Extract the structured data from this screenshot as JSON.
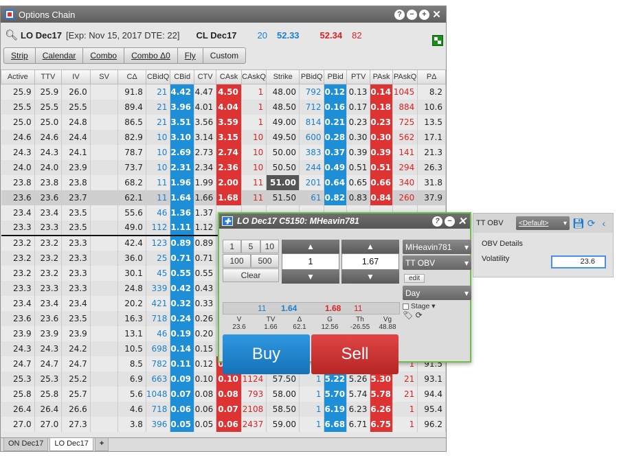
{
  "window": {
    "title": "Options Chain"
  },
  "info": {
    "symbol": "LO Dec17",
    "expiry": "[Exp: Nov 15, 2017 DTE: 22]",
    "underlying": "CL Dec17",
    "bid_qty": "20",
    "bid": "52.33",
    "ask": "52.34",
    "ask_qty": "82"
  },
  "strategies": [
    "Strip",
    "Calendar",
    "Combo",
    "Combo Δ0",
    "Fly",
    "Custom"
  ],
  "columns": [
    "Active",
    "TTV",
    "IV",
    "SV",
    "CΔ",
    "CBidQ",
    "CBid",
    "CTV",
    "CAsk",
    "CAskQ",
    "Strike",
    "PBidQ",
    "PBid",
    "PTV",
    "PAsk",
    "PAskQ",
    "PΔ"
  ],
  "rows": [
    [
      "25.9",
      "25.9",
      "26.0",
      "",
      "91.8",
      "21",
      "4.42",
      "4.47",
      "4.50",
      "1",
      "48.00",
      "792",
      "0.12",
      "0.13",
      "0.14",
      "1045",
      "8.2"
    ],
    [
      "25.5",
      "25.5",
      "25.5",
      "",
      "89.4",
      "21",
      "3.96",
      "4.01",
      "4.04",
      "1",
      "48.50",
      "712",
      "0.16",
      "0.17",
      "0.18",
      "884",
      "10.6"
    ],
    [
      "25.0",
      "25.0",
      "24.8",
      "",
      "86.5",
      "21",
      "3.51",
      "3.56",
      "3.59",
      "1",
      "49.00",
      "814",
      "0.21",
      "0.23",
      "0.23",
      "725",
      "13.5"
    ],
    [
      "24.6",
      "24.6",
      "24.4",
      "",
      "82.9",
      "10",
      "3.10",
      "3.14",
      "3.15",
      "10",
      "49.50",
      "600",
      "0.28",
      "0.30",
      "0.30",
      "562",
      "17.1"
    ],
    [
      "24.3",
      "24.3",
      "24.1",
      "",
      "78.7",
      "10",
      "2.69",
      "2.73",
      "2.74",
      "10",
      "50.00",
      "383",
      "0.37",
      "0.39",
      "0.39",
      "141",
      "21.3"
    ],
    [
      "24.0",
      "24.0",
      "23.9",
      "",
      "73.7",
      "10",
      "2.31",
      "2.34",
      "2.36",
      "10",
      "50.50",
      "244",
      "0.49",
      "0.51",
      "0.51",
      "294",
      "26.3"
    ],
    [
      "23.8",
      "23.8",
      "23.8",
      "",
      "68.2",
      "11",
      "1.96",
      "1.99",
      "2.00",
      "11",
      "51.00",
      "201",
      "0.64",
      "0.65",
      "0.66",
      "340",
      "31.8"
    ],
    [
      "23.6",
      "23.6",
      "23.7",
      "",
      "62.1",
      "11",
      "1.64",
      "1.66",
      "1.68",
      "11",
      "51.50",
      "61",
      "0.82",
      "0.83",
      "0.84",
      "260",
      "37.9"
    ],
    [
      "23.4",
      "23.4",
      "23.5",
      "",
      "55.6",
      "46",
      "1.36",
      "1.37",
      "",
      "",
      "",
      "",
      "",
      "",
      "",
      "",
      ""
    ],
    [
      "23.3",
      "23.3",
      "23.5",
      "",
      "49.0",
      "112",
      "1.11",
      "1.12",
      "",
      "",
      "",
      "",
      "",
      "",
      "",
      "",
      ""
    ],
    [
      "23.2",
      "23.2",
      "23.3",
      "",
      "42.4",
      "123",
      "0.89",
      "0.89",
      "",
      "",
      "",
      "",
      "",
      "",
      "",
      "",
      ""
    ],
    [
      "23.2",
      "23.2",
      "23.3",
      "",
      "36.0",
      "25",
      "0.71",
      "0.71",
      "",
      "",
      "",
      "",
      "",
      "",
      "",
      "",
      ""
    ],
    [
      "23.2",
      "23.2",
      "23.3",
      "",
      "30.1",
      "45",
      "0.55",
      "0.55",
      "",
      "",
      "",
      "",
      "",
      "",
      "",
      "",
      ""
    ],
    [
      "23.3",
      "23.3",
      "23.3",
      "",
      "24.8",
      "339",
      "0.42",
      "0.43",
      "",
      "",
      "",
      "",
      "",
      "",
      "",
      "",
      ""
    ],
    [
      "23.4",
      "23.4",
      "23.4",
      "",
      "20.2",
      "421",
      "0.32",
      "0.33",
      "",
      "",
      "",
      "",
      "",
      "",
      "",
      "",
      ""
    ],
    [
      "23.6",
      "23.6",
      "23.5",
      "",
      "16.3",
      "718",
      "0.24",
      "0.26",
      "",
      "",
      "",
      "",
      "",
      "",
      "",
      "",
      ""
    ],
    [
      "23.9",
      "23.9",
      "23.9",
      "",
      "13.1",
      "46",
      "0.19",
      "0.20",
      "",
      "",
      "",
      "",
      "",
      "",
      "",
      "",
      ""
    ],
    [
      "24.3",
      "24.3",
      "24.2",
      "",
      "10.5",
      "698",
      "0.14",
      "0.15",
      "",
      "",
      "",
      "",
      "",
      "",
      "",
      "",
      ""
    ],
    [
      "24.7",
      "24.7",
      "24.7",
      "",
      "8.5",
      "782",
      "0.11",
      "0.12",
      "0.13",
      "1282",
      "57.00",
      "1",
      "4.75",
      "4.78",
      "4.82",
      "1",
      "91.5"
    ],
    [
      "25.3",
      "25.3",
      "25.2",
      "",
      "6.9",
      "663",
      "0.09",
      "0.10",
      "0.10",
      "1124",
      "57.50",
      "1",
      "5.22",
      "5.26",
      "5.30",
      "21",
      "93.1"
    ],
    [
      "25.8",
      "25.8",
      "25.7",
      "",
      "5.6",
      "1048",
      "0.07",
      "0.08",
      "0.08",
      "793",
      "58.00",
      "1",
      "5.70",
      "5.74",
      "5.78",
      "21",
      "94.4"
    ],
    [
      "26.4",
      "26.4",
      "26.6",
      "",
      "4.6",
      "718",
      "0.06",
      "0.06",
      "0.07",
      "2108",
      "58.50",
      "1",
      "6.19",
      "6.23",
      "6.26",
      "1",
      "95.4"
    ],
    [
      "27.0",
      "27.0",
      "27.3",
      "",
      "3.8",
      "396",
      "0.05",
      "0.05",
      "0.06",
      "2437",
      "59.00",
      "1",
      "6.68",
      "6.71",
      "6.75",
      "1",
      "96.2"
    ]
  ],
  "bottom_tabs": [
    "ON Dec17",
    "LO Dec17",
    "+"
  ],
  "ticket": {
    "title": "LO Dec17 C5150: MHeavin781",
    "qty_buttons": [
      "1",
      "5",
      "10",
      "100",
      "500",
      "Clear"
    ],
    "qty_value": "1",
    "price_value": "1.67",
    "account": "MHeavin781",
    "order_type": "TT OBV",
    "edit_label": "edit",
    "tif": "Day",
    "stage_label": "Stage",
    "market": {
      "bid_qty": "11",
      "bid": "1.64",
      "ask": "1.68",
      "ask_qty": "11"
    },
    "greeks": [
      {
        "label": "V",
        "value": "23.6"
      },
      {
        "label": "TV",
        "value": "1.66"
      },
      {
        "label": "Δ",
        "value": "62.1"
      },
      {
        "label": "G",
        "value": "12.56"
      },
      {
        "label": "Th",
        "value": "-26.55"
      },
      {
        "label": "Vg",
        "value": "48.88"
      }
    ],
    "buy_label": "Buy",
    "sell_label": "Sell"
  },
  "obv": {
    "label": "TT OBV",
    "preset": "<Default>",
    "details_title": "OBV Details",
    "volatility_label": "Volatility",
    "volatility_value": "23.6"
  }
}
